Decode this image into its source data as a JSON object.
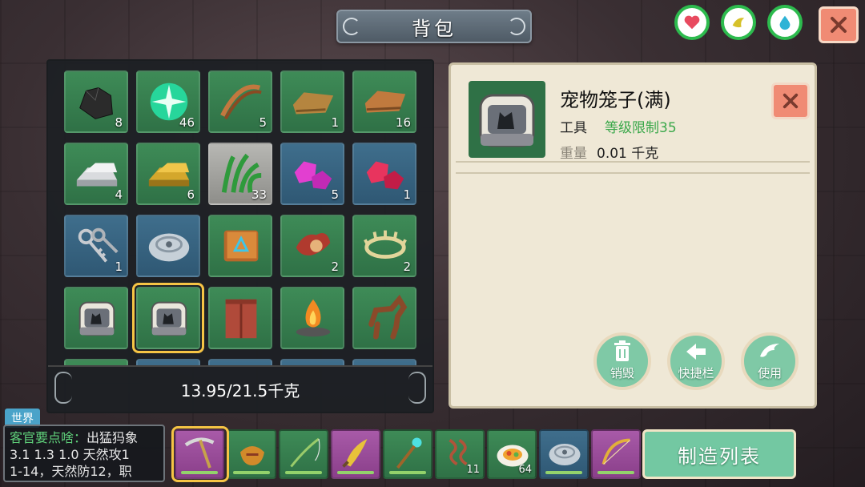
{
  "window": {
    "title": "背包"
  },
  "colors": {
    "accent_green": "#2dbb4e",
    "close_red": "#f08b74",
    "panel_bg": "#efe8d6",
    "level_green": "#3aa84a",
    "chat_green": "#5fd07a"
  },
  "status_icons": [
    {
      "name": "heart-icon",
      "fill": 0.85
    },
    {
      "name": "food-icon",
      "fill": 0.7
    },
    {
      "name": "water-icon",
      "fill": 0.8
    }
  ],
  "inventory": {
    "slots": [
      {
        "icon": "coal-icon",
        "qty": "8",
        "bg": "green"
      },
      {
        "icon": "gem-orb-icon",
        "qty": "46",
        "bg": "green"
      },
      {
        "icon": "bow-string-icon",
        "qty": "5",
        "bg": "green"
      },
      {
        "icon": "leather-icon",
        "qty": "1",
        "bg": "green"
      },
      {
        "icon": "hide-icon",
        "qty": "16",
        "bg": "green"
      },
      {
        "icon": "iron-ingot-icon",
        "qty": "4",
        "bg": "green"
      },
      {
        "icon": "gold-ingot-icon",
        "qty": "6",
        "bg": "green"
      },
      {
        "icon": "grass-icon",
        "qty": "33",
        "bg": "gray"
      },
      {
        "icon": "pink-gem-icon",
        "qty": "5",
        "bg": "blue"
      },
      {
        "icon": "red-gem-icon",
        "qty": "1",
        "bg": "blue"
      },
      {
        "icon": "keys-icon",
        "qty": "1",
        "bg": "blue"
      },
      {
        "icon": "stone-disc-icon",
        "qty": "",
        "bg": "blue"
      },
      {
        "icon": "spell-book-icon",
        "qty": "",
        "bg": "green"
      },
      {
        "icon": "saddle-icon",
        "qty": "2",
        "bg": "green"
      },
      {
        "icon": "thorn-crown-icon",
        "qty": "2",
        "bg": "green"
      },
      {
        "icon": "pet-cage-icon",
        "qty": "",
        "bg": "green"
      },
      {
        "icon": "pet-cage-icon",
        "qty": "",
        "bg": "green"
      },
      {
        "icon": "wardrobe-icon",
        "qty": "",
        "bg": "green"
      },
      {
        "icon": "campfire-icon",
        "qty": "",
        "bg": "green"
      },
      {
        "icon": "horse-icon",
        "qty": "",
        "bg": "green"
      },
      {
        "icon": "partial-slot",
        "qty": "",
        "bg": "green"
      },
      {
        "icon": "partial-slot",
        "qty": "",
        "bg": "blue"
      },
      {
        "icon": "partial-slot",
        "qty": "",
        "bg": "blue"
      },
      {
        "icon": "partial-slot",
        "qty": "",
        "bg": "blue"
      },
      {
        "icon": "partial-slot",
        "qty": "",
        "bg": "blue"
      }
    ],
    "selected_index": 16,
    "weight": "13.95/21.5千克"
  },
  "detail": {
    "name": "宠物笼子(满)",
    "type": "工具",
    "level_req": "等级限制35",
    "weight_label": "重量",
    "weight_value": "0.01 千克",
    "actions": {
      "destroy": "销毁",
      "hotbar": "快捷栏",
      "use": "使用"
    }
  },
  "chat": {
    "channel": "世界",
    "line1_speaker": "客官要点啥：",
    "line1_text": "出猛犸象",
    "line2": "3.1  1.3  1.0  天然攻1",
    "line3": "1-14，天然防12，职"
  },
  "hotbar": {
    "items": [
      {
        "icon": "pickaxe-icon",
        "qty": "",
        "bg": "purple"
      },
      {
        "icon": "pouch-icon",
        "qty": "",
        "bg": "green"
      },
      {
        "icon": "fishing-rod-icon",
        "qty": "",
        "bg": "green"
      },
      {
        "icon": "blade-icon",
        "qty": "",
        "bg": "purple"
      },
      {
        "icon": "staff-icon",
        "qty": "",
        "bg": "green"
      },
      {
        "icon": "rope-icon",
        "qty": "11",
        "bg": "green"
      },
      {
        "icon": "food-plate-icon",
        "qty": "64",
        "bg": "green"
      },
      {
        "icon": "stone-disc-icon",
        "qty": "",
        "bg": "blue"
      },
      {
        "icon": "bow-icon",
        "qty": "",
        "bg": "purple"
      }
    ],
    "selected_index": 0,
    "craft_button": "制造列表"
  }
}
